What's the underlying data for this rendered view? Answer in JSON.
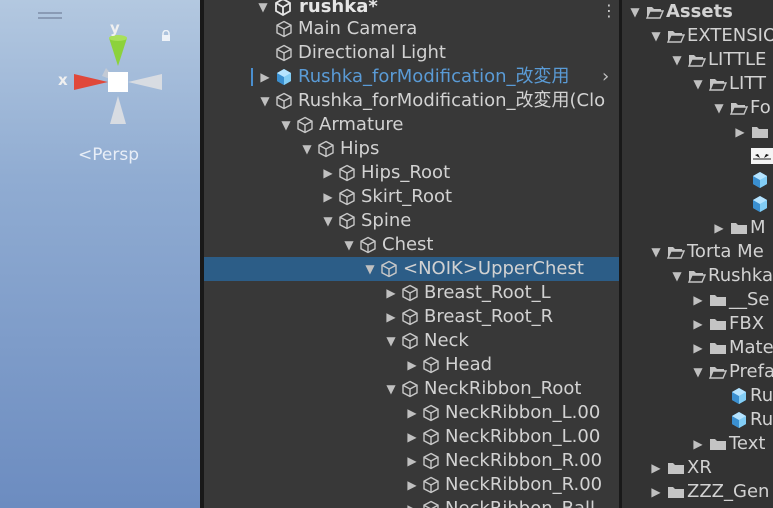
{
  "scene": {
    "axis_y": "y",
    "axis_x": "x",
    "persp_label": "<Persp",
    "icons": [
      "menu-icon",
      "lock-icon",
      "axis-gizmo-icon"
    ]
  },
  "hierarchy": {
    "scene_name": "rushka*",
    "more_menu": "⋮",
    "rows": [
      {
        "label": "Main Camera",
        "indent": 0,
        "arrow": "",
        "icon": "gameobject-cube-icon"
      },
      {
        "label": "Directional Light",
        "indent": 0,
        "arrow": "",
        "icon": "gameobject-cube-icon"
      },
      {
        "label": "Rushka_forModification_改変用",
        "indent": 0,
        "arrow": "▶",
        "icon": "prefab-cube-icon",
        "blue": true,
        "trail": "›"
      },
      {
        "label": "Rushka_forModification_改変用(Clo",
        "indent": 0,
        "arrow": "▼",
        "icon": "gameobject-cube-icon"
      },
      {
        "label": "Armature",
        "indent": 1,
        "arrow": "▼",
        "icon": "gameobject-cube-icon"
      },
      {
        "label": "Hips",
        "indent": 2,
        "arrow": "▼",
        "icon": "gameobject-cube-icon"
      },
      {
        "label": "Hips_Root",
        "indent": 3,
        "arrow": "▶",
        "icon": "gameobject-cube-icon"
      },
      {
        "label": "Skirt_Root",
        "indent": 3,
        "arrow": "▶",
        "icon": "gameobject-cube-icon"
      },
      {
        "label": "Spine",
        "indent": 3,
        "arrow": "▼",
        "icon": "gameobject-cube-icon"
      },
      {
        "label": "Chest",
        "indent": 4,
        "arrow": "▼",
        "icon": "gameobject-cube-icon"
      },
      {
        "label": "<NOIK>UpperChest",
        "indent": 5,
        "arrow": "▼",
        "icon": "gameobject-cube-icon",
        "selected": true
      },
      {
        "label": "Breast_Root_L",
        "indent": 6,
        "arrow": "▶",
        "icon": "gameobject-cube-icon"
      },
      {
        "label": "Breast_Root_R",
        "indent": 6,
        "arrow": "▶",
        "icon": "gameobject-cube-icon"
      },
      {
        "label": "Neck",
        "indent": 6,
        "arrow": "▼",
        "icon": "gameobject-cube-icon"
      },
      {
        "label": "Head",
        "indent": 7,
        "arrow": "▶",
        "icon": "gameobject-cube-icon"
      },
      {
        "label": "NeckRibbon_Root",
        "indent": 6,
        "arrow": "▼",
        "icon": "gameobject-cube-icon"
      },
      {
        "label": "NeckRibbon_L.00",
        "indent": 7,
        "arrow": "▶",
        "icon": "gameobject-cube-icon"
      },
      {
        "label": "NeckRibbon_L.00",
        "indent": 7,
        "arrow": "▶",
        "icon": "gameobject-cube-icon"
      },
      {
        "label": "NeckRibbon_R.00",
        "indent": 7,
        "arrow": "▶",
        "icon": "gameobject-cube-icon"
      },
      {
        "label": "NeckRibbon_R.00",
        "indent": 7,
        "arrow": "▶",
        "icon": "gameobject-cube-icon"
      },
      {
        "label": "NeckRibbon_Ball",
        "indent": 7,
        "arrow": "▶",
        "icon": "gameobject-cube-icon"
      }
    ]
  },
  "project": {
    "rows": [
      {
        "label": "Assets",
        "indent": 0,
        "arrow": "▼",
        "icon": "folder-open-icon",
        "bold": true
      },
      {
        "label": "EXTENSIO",
        "indent": 1,
        "arrow": "▼",
        "icon": "folder-open-icon"
      },
      {
        "label": "LITTLE",
        "indent": 2,
        "arrow": "▼",
        "icon": "folder-open-icon"
      },
      {
        "label": "LITT",
        "indent": 3,
        "arrow": "▼",
        "icon": "folder-open-icon"
      },
      {
        "label": "Fo",
        "indent": 4,
        "arrow": "▼",
        "icon": "folder-open-icon"
      },
      {
        "label": "",
        "indent": 5,
        "arrow": "▶",
        "icon": "folder-icon"
      },
      {
        "label": "",
        "indent": 5,
        "arrow": "",
        "icon": "texture-icon"
      },
      {
        "label": "",
        "indent": 5,
        "arrow": "",
        "icon": "prefab-cube-icon"
      },
      {
        "label": "",
        "indent": 5,
        "arrow": "",
        "icon": "prefab-cube-icon"
      },
      {
        "label": "M",
        "indent": 4,
        "arrow": "▶",
        "icon": "folder-icon"
      },
      {
        "label": "Torta Me",
        "indent": 1,
        "arrow": "▼",
        "icon": "folder-open-icon"
      },
      {
        "label": "Rushka",
        "indent": 2,
        "arrow": "▼",
        "icon": "folder-open-icon"
      },
      {
        "label": "__Se",
        "indent": 3,
        "arrow": "▶",
        "icon": "folder-icon"
      },
      {
        "label": "FBX",
        "indent": 3,
        "arrow": "▶",
        "icon": "folder-icon"
      },
      {
        "label": "Mate",
        "indent": 3,
        "arrow": "▶",
        "icon": "folder-icon"
      },
      {
        "label": "Prefa",
        "indent": 3,
        "arrow": "▼",
        "icon": "folder-open-icon"
      },
      {
        "label": "Ru",
        "indent": 4,
        "arrow": "",
        "icon": "prefab-cube-icon"
      },
      {
        "label": "Ru",
        "indent": 4,
        "arrow": "",
        "icon": "prefab-cube-icon"
      },
      {
        "label": "Text",
        "indent": 3,
        "arrow": "▶",
        "icon": "folder-icon"
      },
      {
        "label": "XR",
        "indent": 1,
        "arrow": "▶",
        "icon": "folder-icon"
      },
      {
        "label": "ZZZ_Gen",
        "indent": 1,
        "arrow": "▶",
        "icon": "folder-icon"
      }
    ]
  }
}
